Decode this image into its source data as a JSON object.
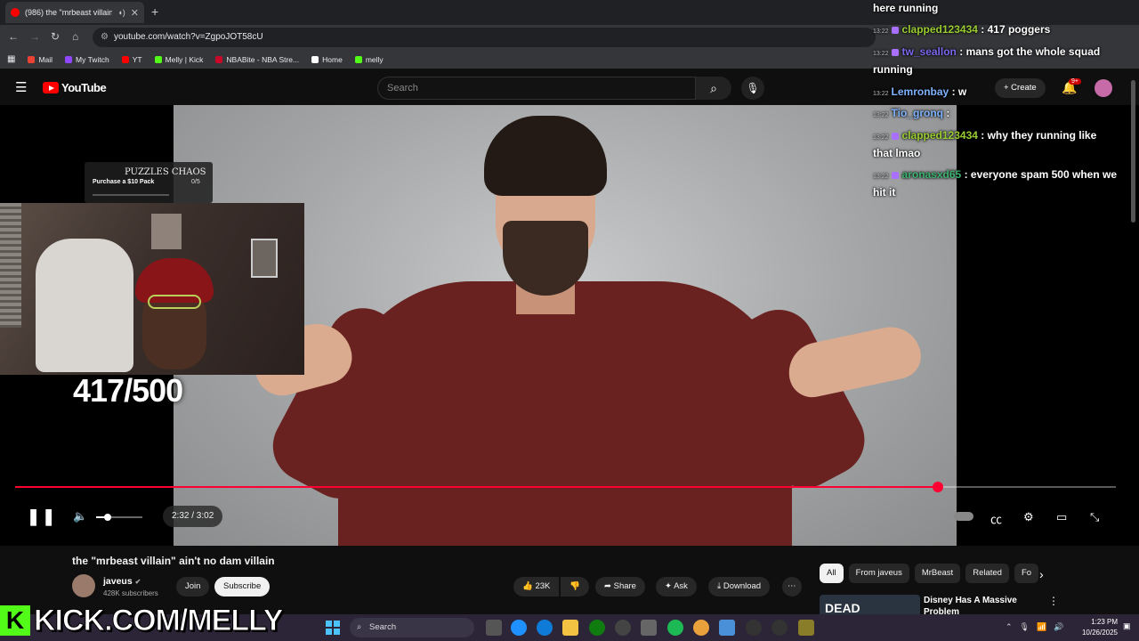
{
  "browser": {
    "tab_title": "(986) the \"mrbeast villain\" ...",
    "url": "youtube.com/watch?v=ZgpoJOT58cU",
    "bookmarks": [
      {
        "label": "Mail",
        "color": "#ea4335"
      },
      {
        "label": "My Twitch",
        "color": "#9146ff"
      },
      {
        "label": "YT",
        "color": "#ff0000"
      },
      {
        "label": "Melly | Kick",
        "color": "#53fc18"
      },
      {
        "label": "NBABite - NBA Stre...",
        "color": "#c9082a"
      },
      {
        "label": "Home",
        "color": "#ffffff"
      },
      {
        "label": "melly",
        "color": "#53fc18"
      }
    ]
  },
  "youtube": {
    "logo_text": "YouTube",
    "search_placeholder": "Search",
    "create_label": "+ Create",
    "notif_badge": "9+"
  },
  "video": {
    "promo_logo": "PUZZLES CHAOS",
    "promo_label": "Purchase a $10 Pack",
    "promo_count": "0/5",
    "counter_overlay": "417/500",
    "time_display": "2:32 / 3:02",
    "progress_fraction": 0.838,
    "volume_fraction": 0.25,
    "accent_color": "#ff0033"
  },
  "chat": [
    {
      "ts": "",
      "user": "",
      "user_color": "#ffffff",
      "msg": "here running",
      "badge": false
    },
    {
      "ts": "13:22",
      "user": "clapped123434",
      "user_color": "#9acd32",
      "msg": ": 417 poggers",
      "badge": true
    },
    {
      "ts": "13:22",
      "user": "tw_seallon",
      "user_color": "#7b68ee",
      "msg": ": mans got the whole squad",
      "badge": true
    },
    {
      "ts": "",
      "user": "",
      "user_color": "#ffffff",
      "msg": "running",
      "badge": false
    },
    {
      "ts": "13:22",
      "user": "Lemronbay",
      "user_color": "#7fb2ff",
      "msg": ": w",
      "badge": false
    },
    {
      "ts": "13:22",
      "user": "Tio_gronq",
      "user_color": "#7fb2ff",
      "msg": ":",
      "badge": false
    },
    {
      "ts": "13:22",
      "user": "clapped123434",
      "user_color": "#9acd32",
      "msg": ": why they running like",
      "badge": true
    },
    {
      "ts": "",
      "user": "",
      "user_color": "#ffffff",
      "msg": "that lmao",
      "badge": false
    },
    {
      "ts": "13:22",
      "user": "aronasxd65",
      "user_color": "#3cb371",
      "msg": ": everyone spam 500 when we",
      "badge": true
    },
    {
      "ts": "",
      "user": "",
      "user_color": "#ffffff",
      "msg": "hit it",
      "badge": false
    }
  ],
  "below": {
    "title": "the \"mrbeast villain\" ain't no dam villain",
    "channel": "javeus",
    "subs": "428K subscribers",
    "join": "Join",
    "subscribe": "Subscribe",
    "likes": "23K",
    "share": "Share",
    "ask": "Ask",
    "download": "Download",
    "chips": [
      "All",
      "From javeus",
      "MrBeast",
      "Related",
      "Fo"
    ],
    "rec_thumb_text": "DEAD",
    "rec_title": "Disney Has A Massive Problem"
  },
  "overlay": {
    "kick_text": "KICK.COM/MELLY",
    "kick_letter": "K"
  },
  "taskbar": {
    "search": "Search",
    "time": "1:23 PM",
    "date": "10/26/2025"
  }
}
